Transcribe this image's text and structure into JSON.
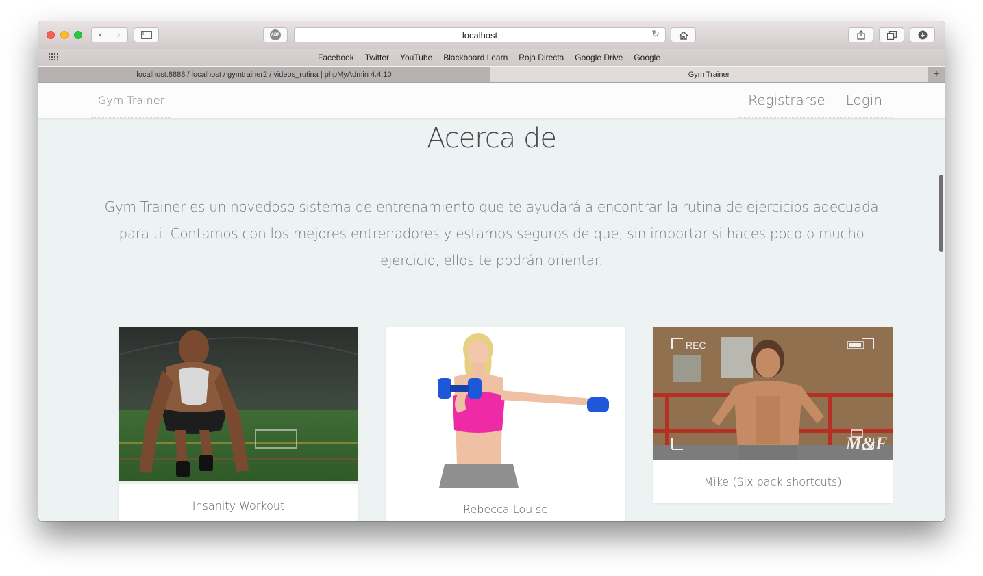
{
  "browser": {
    "url": "localhost",
    "abp_label": "ABP",
    "bookmarks": [
      "Facebook",
      "Twitter",
      "YouTube",
      "Blackboard Learn",
      "Roja Directa",
      "Google Drive",
      "Google"
    ],
    "tabs": [
      {
        "title": "localhost:8888 / localhost / gymtrainer2 / videos_rutina | phpMyAdmin 4.4.10",
        "active": false
      },
      {
        "title": "Gym Trainer",
        "active": true
      }
    ]
  },
  "site": {
    "brand": "Gym Trainer",
    "nav": [
      "Registrarse",
      "Login"
    ],
    "about_title": "Acerca de",
    "about_text": "Gym Trainer es un novedoso sistema de entrenamiento que te ayudará a encontrar la rutina de ejercicios adecuada para ti. Contamos con los mejores entrenadores y estamos seguros de que, sin importar si haces poco o mucho ejercicio, ellos te podrán orientar.",
    "trainers": [
      {
        "name": "Insanity Workout"
      },
      {
        "name": "Rebecca Louise"
      },
      {
        "name": "Mike (Six pack shortcuts)"
      }
    ],
    "photo_overlay": {
      "rec": "REC",
      "logo": "M&F"
    }
  }
}
